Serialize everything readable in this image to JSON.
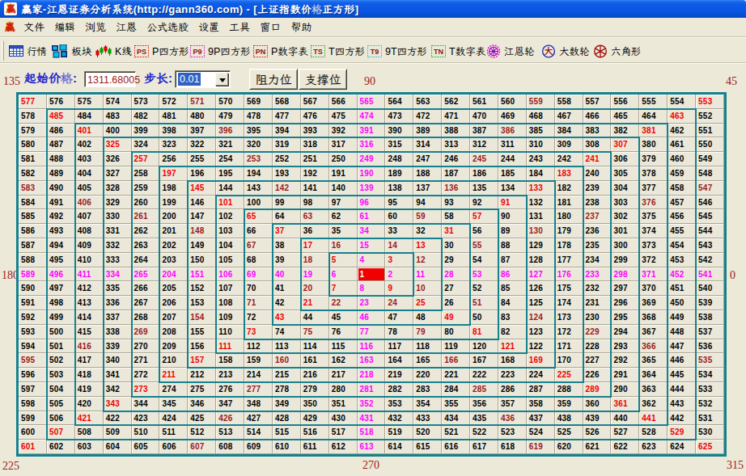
{
  "window": {
    "title": "赢家-江恩证券分析系统(http://gann360.com) - [上证指数价格正方形]",
    "icon": "winner-logo-icon"
  },
  "menu": {
    "icon": "winner-logo-icon",
    "items": [
      {
        "label": "文件"
      },
      {
        "label": "编辑"
      },
      {
        "label": "浏览"
      },
      {
        "label": "江恩"
      },
      {
        "label": "公式选股"
      },
      {
        "label": "设置"
      },
      {
        "label": "工具"
      },
      {
        "label": "窗口"
      },
      {
        "label": "帮助"
      }
    ]
  },
  "toolbar": {
    "items": [
      {
        "label": "行情",
        "icon": "quotes-table-icon"
      },
      {
        "label": "板块",
        "icon": "blocks-icon"
      },
      {
        "label": "K线",
        "icon": "kline-candles-icon"
      },
      {
        "label": "P四方形",
        "icon": "ps-badge-icon",
        "badge": "PS",
        "badge_border": "#e80000"
      },
      {
        "label": "9P四方形",
        "icon": "p9-badge-icon",
        "badge": "P9",
        "badge_border": "#dd00dd"
      },
      {
        "label": "P数字表",
        "icon": "pn-badge-icon",
        "badge": "PN",
        "badge_border": "#e80000"
      },
      {
        "label": "T四方形",
        "icon": "ts-badge-icon",
        "badge": "TS",
        "badge_border": "#00aa22"
      },
      {
        "label": "9T四方形",
        "icon": "t9-badge-icon",
        "badge": "T9",
        "badge_border": "#00bbee"
      },
      {
        "label": "T数字表",
        "icon": "tn-badge-icon",
        "badge": "TN",
        "badge_border": "#00aa22"
      },
      {
        "label": "江恩轮",
        "icon": "gann-wheel-icon"
      },
      {
        "label": "大数轮",
        "icon": "big-number-wheel-icon",
        "glyph": "大"
      },
      {
        "label": "六角形",
        "icon": "hexagon-wheel-icon"
      }
    ]
  },
  "controls": {
    "start_price_label": "起始价格:",
    "start_price_value": "1311.68005",
    "step_label": "步长:",
    "step_value": "0.01",
    "resistance_button": "阻力位",
    "support_button": "支撑位"
  },
  "angle_labels": {
    "top_left": "135",
    "top_center": "90",
    "top_right": "45",
    "middle_left": "180",
    "middle_right": "0",
    "bottom_left": "225",
    "bottom_center": "270",
    "bottom_right": "315"
  },
  "colors": {
    "titlebar_blue": "#0b5ae0",
    "chrome_beige": "#ece9d8",
    "cell_beige": "#ebe8da",
    "ring_teal": "#15818e",
    "diagonal_red": "#f00000",
    "cardinal_magenta": "#ff00ff",
    "gann2x1_maroon": "#9b1b1b",
    "number_black": "#000000",
    "center_bg_red": "#f00000",
    "label_blue": "#2222cc",
    "value_dark_red": "#9b1b1b",
    "selection_blue": "#2f62c4"
  },
  "chart_data": {
    "type": "table",
    "title": "上证指数价格正方形 (Gann square of numbers, 25×25 spiral)",
    "size": 25,
    "min_value": 1,
    "max_value": 625,
    "center_value": 1,
    "center_highlighted": true,
    "rows": [
      [
        577,
        576,
        575,
        574,
        573,
        572,
        571,
        570,
        569,
        568,
        567,
        566,
        565,
        564,
        563,
        562,
        561,
        560,
        559,
        558,
        557,
        556,
        555,
        554,
        553
      ],
      [
        578,
        485,
        484,
        483,
        482,
        481,
        480,
        479,
        478,
        477,
        476,
        475,
        474,
        473,
        472,
        471,
        470,
        469,
        468,
        467,
        466,
        465,
        464,
        463,
        552
      ],
      [
        579,
        486,
        401,
        400,
        399,
        398,
        397,
        396,
        395,
        394,
        393,
        392,
        391,
        390,
        389,
        388,
        387,
        386,
        385,
        384,
        383,
        382,
        381,
        462,
        551
      ],
      [
        580,
        487,
        402,
        325,
        324,
        323,
        322,
        321,
        320,
        319,
        318,
        317,
        316,
        315,
        314,
        313,
        312,
        311,
        310,
        309,
        308,
        307,
        380,
        461,
        550
      ],
      [
        581,
        488,
        403,
        326,
        257,
        256,
        255,
        254,
        253,
        252,
        251,
        250,
        249,
        248,
        247,
        246,
        245,
        244,
        243,
        242,
        241,
        306,
        379,
        460,
        549
      ],
      [
        582,
        489,
        404,
        327,
        258,
        197,
        196,
        195,
        194,
        193,
        192,
        191,
        190,
        189,
        188,
        187,
        186,
        185,
        184,
        183,
        240,
        305,
        378,
        459,
        548
      ],
      [
        583,
        490,
        405,
        328,
        259,
        198,
        145,
        144,
        143,
        142,
        141,
        140,
        139,
        138,
        137,
        136,
        135,
        134,
        133,
        182,
        239,
        304,
        377,
        458,
        547
      ],
      [
        584,
        491,
        406,
        329,
        260,
        199,
        146,
        101,
        100,
        99,
        98,
        97,
        96,
        95,
        94,
        93,
        92,
        91,
        132,
        181,
        238,
        303,
        376,
        457,
        546
      ],
      [
        585,
        492,
        407,
        330,
        261,
        200,
        147,
        102,
        65,
        64,
        63,
        62,
        61,
        60,
        59,
        58,
        57,
        90,
        131,
        180,
        237,
        302,
        375,
        456,
        545
      ],
      [
        586,
        493,
        408,
        331,
        262,
        201,
        148,
        103,
        66,
        37,
        36,
        35,
        34,
        33,
        32,
        31,
        56,
        89,
        130,
        179,
        236,
        301,
        374,
        455,
        544
      ],
      [
        587,
        494,
        409,
        332,
        263,
        202,
        149,
        104,
        67,
        38,
        17,
        16,
        15,
        14,
        13,
        30,
        55,
        88,
        129,
        178,
        235,
        300,
        373,
        454,
        543
      ],
      [
        588,
        495,
        410,
        333,
        264,
        203,
        150,
        105,
        68,
        39,
        18,
        5,
        4,
        3,
        12,
        29,
        54,
        87,
        128,
        177,
        234,
        299,
        372,
        453,
        542
      ],
      [
        589,
        496,
        411,
        334,
        265,
        204,
        151,
        106,
        69,
        40,
        19,
        6,
        1,
        2,
        11,
        28,
        53,
        86,
        127,
        176,
        233,
        298,
        371,
        452,
        541
      ],
      [
        590,
        497,
        412,
        335,
        266,
        205,
        152,
        107,
        70,
        41,
        20,
        7,
        8,
        9,
        10,
        27,
        52,
        85,
        126,
        175,
        232,
        297,
        370,
        451,
        540
      ],
      [
        591,
        498,
        413,
        336,
        267,
        206,
        153,
        108,
        71,
        42,
        21,
        22,
        23,
        24,
        25,
        26,
        51,
        84,
        125,
        174,
        231,
        296,
        369,
        450,
        539
      ],
      [
        592,
        499,
        414,
        337,
        268,
        207,
        154,
        109,
        72,
        43,
        44,
        45,
        46,
        47,
        48,
        49,
        50,
        83,
        124,
        173,
        230,
        295,
        368,
        449,
        538
      ],
      [
        593,
        500,
        415,
        338,
        269,
        208,
        155,
        110,
        73,
        74,
        75,
        76,
        77,
        78,
        79,
        80,
        81,
        82,
        123,
        172,
        229,
        294,
        367,
        448,
        537
      ],
      [
        594,
        501,
        416,
        339,
        270,
        209,
        156,
        111,
        112,
        113,
        114,
        115,
        116,
        117,
        118,
        119,
        120,
        121,
        122,
        171,
        228,
        293,
        366,
        447,
        536
      ],
      [
        595,
        502,
        417,
        340,
        271,
        210,
        157,
        158,
        159,
        160,
        161,
        162,
        163,
        164,
        165,
        166,
        167,
        168,
        169,
        170,
        227,
        292,
        365,
        446,
        535
      ],
      [
        596,
        503,
        418,
        341,
        272,
        211,
        212,
        213,
        214,
        215,
        216,
        217,
        218,
        219,
        220,
        221,
        222,
        223,
        224,
        225,
        226,
        291,
        364,
        445,
        534
      ],
      [
        597,
        504,
        419,
        342,
        273,
        274,
        275,
        276,
        277,
        278,
        279,
        280,
        281,
        282,
        283,
        284,
        285,
        286,
        287,
        288,
        289,
        290,
        363,
        444,
        533
      ],
      [
        598,
        505,
        420,
        343,
        344,
        345,
        346,
        347,
        348,
        349,
        350,
        351,
        352,
        353,
        354,
        355,
        356,
        357,
        358,
        359,
        360,
        361,
        362,
        443,
        532
      ],
      [
        599,
        506,
        421,
        422,
        423,
        424,
        425,
        426,
        427,
        428,
        429,
        430,
        431,
        432,
        433,
        434,
        435,
        436,
        437,
        438,
        439,
        440,
        441,
        442,
        531
      ],
      [
        600,
        507,
        508,
        509,
        510,
        511,
        512,
        513,
        514,
        515,
        516,
        517,
        518,
        519,
        520,
        521,
        522,
        523,
        524,
        525,
        526,
        527,
        528,
        529,
        530
      ],
      [
        601,
        602,
        603,
        604,
        605,
        606,
        607,
        608,
        609,
        610,
        611,
        612,
        613,
        614,
        615,
        616,
        617,
        618,
        619,
        620,
        621,
        622,
        623,
        624,
        625
      ]
    ],
    "line_color_rules": {
      "diagonal_45deg_lines": "#f00000",
      "horizontal_vertical_cardinal_lines": "#ff00ff",
      "slope_2x1_and_1x2_lines": "#9b1b1b",
      "other_cells": "#000000",
      "ring_square_outlines": "#15818e"
    }
  }
}
